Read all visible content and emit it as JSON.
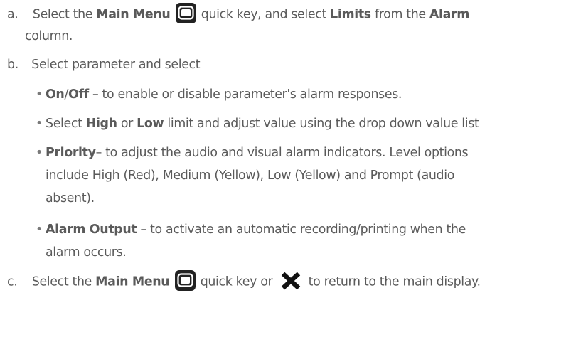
{
  "steps": {
    "a": {
      "marker": "a.",
      "t1": "Select the ",
      "b1": "Main Menu",
      "t2": " quick key, and select ",
      "b2": "Limits",
      "t3": " from the ",
      "b3": "Alarm",
      "cont": "column."
    },
    "b": {
      "marker": "b.",
      "text": "Select parameter and select",
      "bullets": [
        {
          "bold": "On",
          "slash": "/",
          "bold2": "Off",
          "rest": " – to enable or disable parameter's alarm responses."
        },
        {
          "t1": "Select ",
          "bold": "High",
          "t2": " or ",
          "bold2": "Low",
          "rest": " limit and adjust value using the drop down value list"
        },
        {
          "bold": "Priority",
          "rest": "– to adjust the audio and visual alarm indicators. Level options",
          "line2": "include High (Red), Medium (Yellow), Low (Yellow) and Prompt (audio",
          "line3": "absent)."
        },
        {
          "bold": "Alarm Output",
          "rest": " – to activate an automatic recording/printing when the",
          "line2": "alarm occurs."
        }
      ]
    },
    "c": {
      "marker": "c.",
      "t1": "Select the ",
      "b1": "Main Menu",
      "t2": " quick key or ",
      "t3": " to return to the main display."
    }
  },
  "icons": {
    "main_menu": "main-menu-icon",
    "close": "close-x-icon"
  },
  "colors": {
    "text": "#5a5a5a",
    "icon_bg": "#222222",
    "x_icon": "#111111"
  }
}
